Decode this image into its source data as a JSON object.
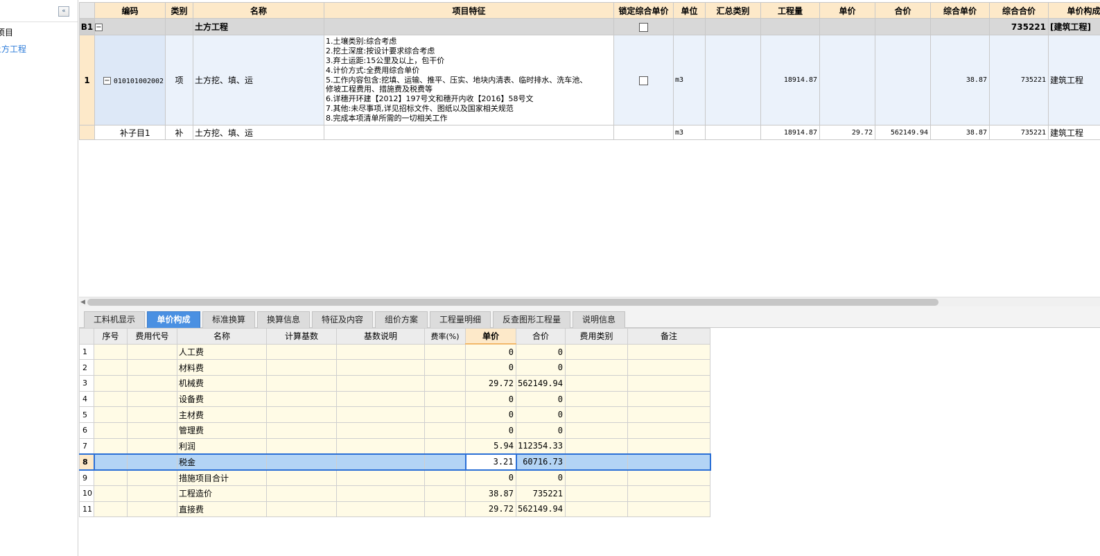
{
  "sidebar": {
    "collapse_icon": "«",
    "root_label": "项目",
    "child_label": "土方工程"
  },
  "upper_grid": {
    "headers": {
      "code": "编码",
      "type": "类别",
      "name": "名称",
      "feature": "项目特征",
      "lock": "锁定综合单价",
      "unit": "单位",
      "summary": "汇总类别",
      "quantity": "工程量",
      "price": "单价",
      "total": "合价",
      "comp_price": "综合单价",
      "comp_total": "综合合价",
      "composition": "单价构成"
    },
    "group_row": {
      "rownum": "B1",
      "expand_icon": "−",
      "name": "土方工程",
      "comp_total": "735221",
      "composition": "[建筑工程]"
    },
    "item_row": {
      "rownum": "1",
      "expand_icon": "−",
      "code": "010101002002",
      "type": "项",
      "name": "土方挖、填、运",
      "feature_lines": [
        "1.土壤类别:综合考虑",
        "2.挖土深度:按设计要求综合考虑",
        "3.弃土运距:15公里及以上，包干价",
        "4.计价方式:全费用综合单价",
        "5.工作内容包含:挖填、运输、推平、压实、地块内清表、临时排水、洗车池、",
        "修坡工程费用、措施费及税费等",
        "6.详穗开环建【2012】197号文和穗开内收【2016】58号文",
        "7.其他:未尽事项,详见招标文件、图纸以及国家相关规范",
        "8.完成本项清单所需的一切相关工作"
      ],
      "unit": "m3",
      "quantity": "18914.87",
      "price": "",
      "total": "",
      "comp_price": "38.87",
      "comp_total": "735221",
      "composition": "建筑工程"
    },
    "sub_row": {
      "code": "补子目1",
      "type": "补",
      "name": "土方挖、填、运",
      "unit": "m3",
      "quantity": "18914.87",
      "price": "29.72",
      "total": "562149.94",
      "comp_price": "38.87",
      "comp_total": "735221",
      "composition": "建筑工程"
    }
  },
  "tabs": [
    {
      "label": "工料机显示",
      "active": false
    },
    {
      "label": "单价构成",
      "active": true
    },
    {
      "label": "标准换算",
      "active": false
    },
    {
      "label": "换算信息",
      "active": false
    },
    {
      "label": "特征及内容",
      "active": false
    },
    {
      "label": "组价方案",
      "active": false
    },
    {
      "label": "工程量明细",
      "active": false
    },
    {
      "label": "反查图形工程量",
      "active": false
    },
    {
      "label": "说明信息",
      "active": false
    }
  ],
  "lower_grid": {
    "headers": {
      "seq": "序号",
      "fee_code": "费用代号",
      "name": "名称",
      "base": "计算基数",
      "base_desc": "基数说明",
      "rate": "费率(%)",
      "price": "单价",
      "total": "合价",
      "fee_type": "费用类别",
      "remark": "备注"
    },
    "rows": [
      {
        "n": "1",
        "name": "人工费",
        "price": "0",
        "total": "0"
      },
      {
        "n": "2",
        "name": "材料费",
        "price": "0",
        "total": "0"
      },
      {
        "n": "3",
        "name": "机械费",
        "price": "29.72",
        "total": "562149.94"
      },
      {
        "n": "4",
        "name": "设备费",
        "price": "0",
        "total": "0"
      },
      {
        "n": "5",
        "name": "主材费",
        "price": "0",
        "total": "0"
      },
      {
        "n": "6",
        "name": "管理费",
        "price": "0",
        "total": "0"
      },
      {
        "n": "7",
        "name": "利润",
        "price": "5.94",
        "total": "112354.33"
      },
      {
        "n": "8",
        "name": "税金",
        "price": "3.21",
        "total": "60716.73"
      },
      {
        "n": "9",
        "name": "措施项目合计",
        "price": "0",
        "total": "0"
      },
      {
        "n": "10",
        "name": "工程造价",
        "price": "38.87",
        "total": "735221"
      },
      {
        "n": "11",
        "name": "直接费",
        "price": "29.72",
        "total": "562149.94"
      }
    ],
    "selected_row": "8"
  },
  "colors": {
    "header_bg": "#fde9c9",
    "active_tab": "#4a90e2",
    "selection": "#b3d4f5",
    "link": "#2a7ad9"
  }
}
